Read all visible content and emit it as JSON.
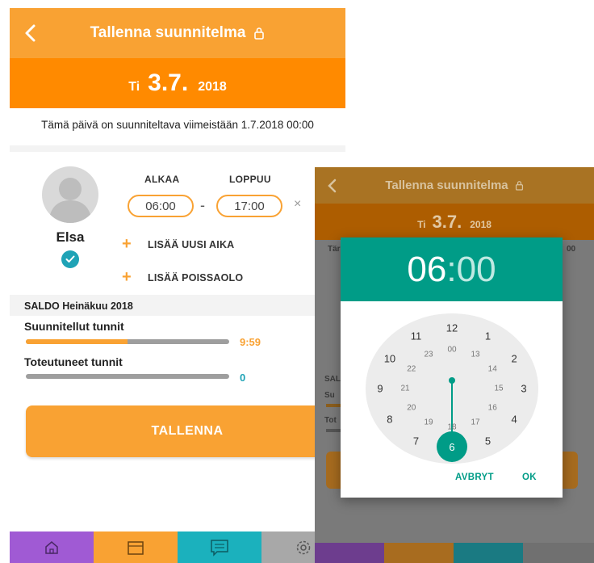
{
  "left": {
    "header": {
      "title": "Tallenna suunnitelma",
      "back_icon": "chevron-left-icon",
      "lock_icon": "lock-icon"
    },
    "date": {
      "weekday": "Ti",
      "day": "3.7.",
      "year": "2018"
    },
    "deadline": "Tämä päivä on suunniteltava viimeistään 1.7.2018 00:00",
    "person": {
      "name": "Elsa",
      "status_icon": "check-icon"
    },
    "time": {
      "start_label": "ALKAA",
      "end_label": "LOPPUU",
      "start": "06:00",
      "end": "17:00",
      "separator": "-",
      "remove": "×"
    },
    "actions": {
      "plus": "+",
      "add_time": "LISÄÄ UUSI AIKA",
      "add_absence": "LISÄÄ POISSAOLO"
    },
    "saldo": {
      "title": "SALDO Heinäkuu 2018",
      "planned": {
        "label": "Suunnitellut tunnit",
        "value": "9:59",
        "fill_fraction": 0.5
      },
      "actual": {
        "label": "Toteutuneet tunnit",
        "value": "0",
        "fill_fraction": 0
      }
    },
    "save_label": "TALLENNA",
    "nav": [
      "home-icon",
      "calendar-icon",
      "message-icon",
      "settings-icon"
    ]
  },
  "right": {
    "header": {
      "title": "Tallenna suunnitelma",
      "back_icon": "chevron-left-icon",
      "lock_icon": "lock-icon"
    },
    "date": {
      "weekday": "Ti",
      "day": "3.7.",
      "year": "2018"
    },
    "peek": {
      "left": "Tär",
      "right": "00",
      "sal": "SAL",
      "su": "Su",
      "tot": "Tot"
    },
    "picker": {
      "hours": "06",
      "colon": ":",
      "minutes": "00",
      "outer": [
        "12",
        "1",
        "2",
        "3",
        "4",
        "5",
        "6",
        "7",
        "8",
        "9",
        "10",
        "11"
      ],
      "inner": [
        "00",
        "13",
        "14",
        "15",
        "16",
        "17",
        "18",
        "19",
        "20",
        "21",
        "22",
        "23"
      ],
      "selected": "6",
      "cancel_label": "AVBRYT",
      "ok_label": "OK"
    }
  },
  "colors": {
    "orange": "#f9a233",
    "deep_orange": "#ff8a00",
    "teal": "#009c87",
    "cyan": "#1fa3b6",
    "purple": "#a05ad4"
  }
}
